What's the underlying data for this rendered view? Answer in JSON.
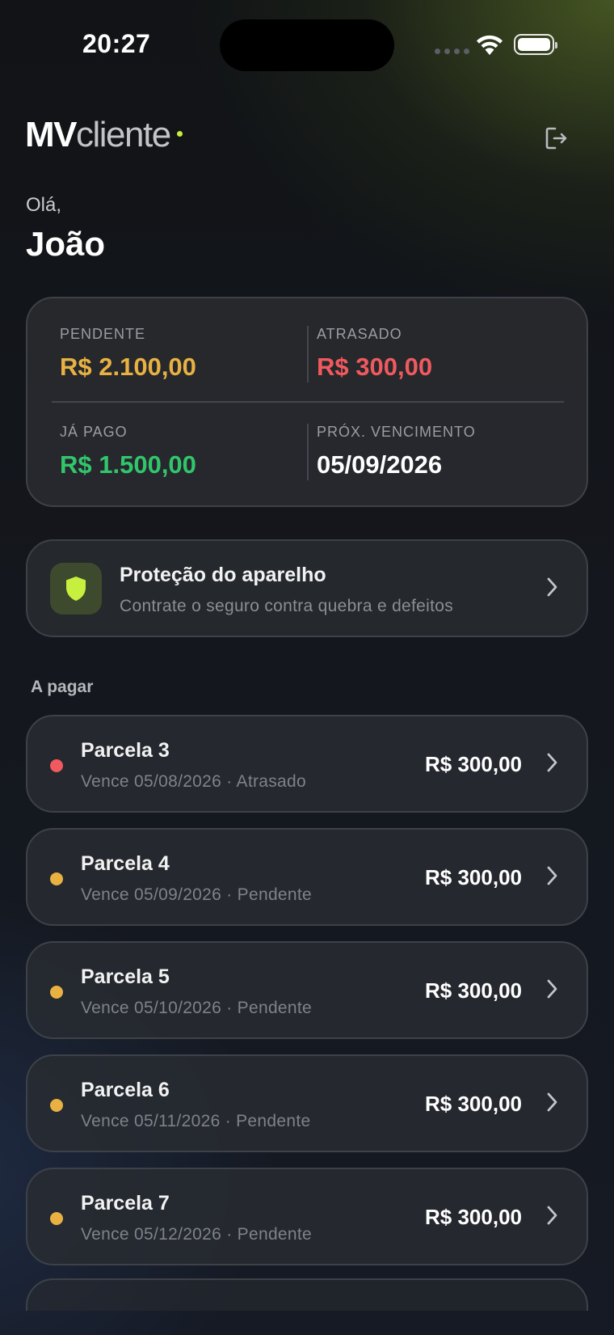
{
  "status_bar": {
    "time": "20:27"
  },
  "header": {
    "brand_strong": "MV",
    "brand_light": "cliente",
    "accent": "#c7ef3e",
    "logout_icon": "logout-icon"
  },
  "greeting": {
    "hello": "Olá,",
    "name": "João"
  },
  "summary": {
    "pending": {
      "label": "PENDENTE",
      "value": "R$ 2.100,00",
      "color": "#e8b142"
    },
    "overdue": {
      "label": "ATRASADO",
      "value": "R$ 300,00",
      "color": "#f05a5f"
    },
    "paid": {
      "label": "JÁ PAGO",
      "value": "R$ 1.500,00",
      "color": "#32c66c"
    },
    "next_due": {
      "label": "PRÓX. VENCIMENTO",
      "value": "05/09/2026"
    }
  },
  "protection": {
    "icon": "shield-icon",
    "title": "Proteção do aparelho",
    "subtitle": "Contrate o seguro contra quebra e defeitos"
  },
  "section": {
    "title": "A pagar"
  },
  "installments": [
    {
      "title": "Parcela 3",
      "subtitle": "Vence 05/08/2026 · Atrasado",
      "amount": "R$ 300,00",
      "status_color": "#f05a5f"
    },
    {
      "title": "Parcela 4",
      "subtitle": "Vence 05/09/2026 · Pendente",
      "amount": "R$ 300,00",
      "status_color": "#e8b142"
    },
    {
      "title": "Parcela 5",
      "subtitle": "Vence 05/10/2026 · Pendente",
      "amount": "R$ 300,00",
      "status_color": "#e8b142"
    },
    {
      "title": "Parcela 6",
      "subtitle": "Vence 05/11/2026 · Pendente",
      "amount": "R$ 300,00",
      "status_color": "#e8b142"
    },
    {
      "title": "Parcela 7",
      "subtitle": "Vence 05/12/2026 · Pendente",
      "amount": "R$ 300,00",
      "status_color": "#e8b142"
    }
  ]
}
